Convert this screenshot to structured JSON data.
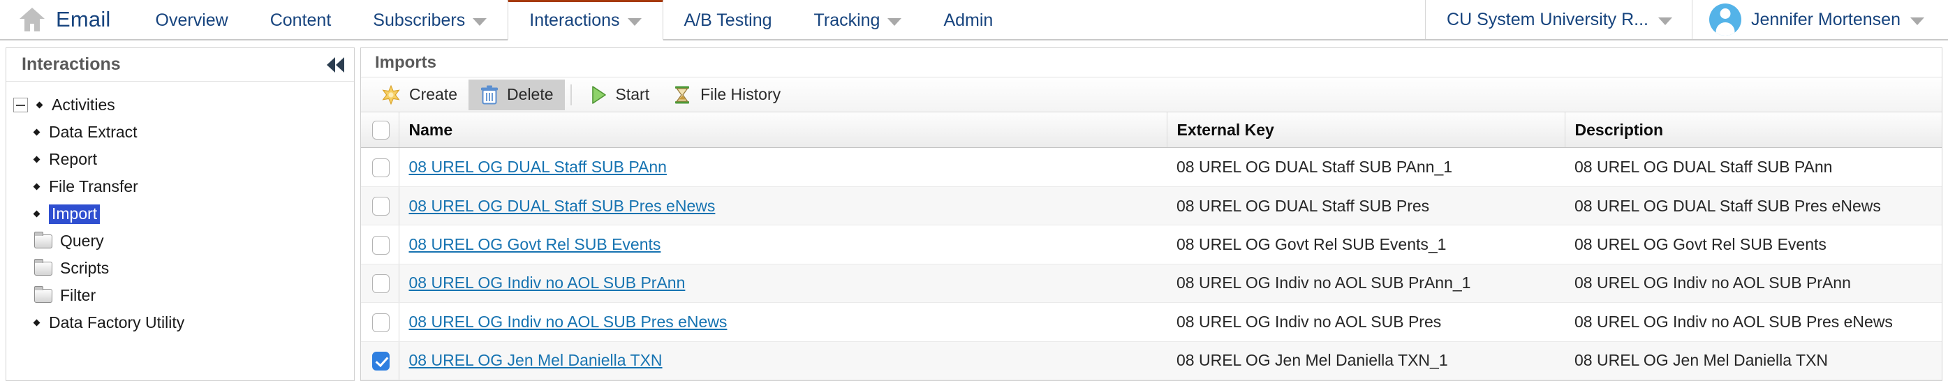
{
  "topnav": {
    "home_icon": "home-icon",
    "app_title": "Email",
    "items": [
      {
        "label": "Overview",
        "has_caret": false,
        "active": false
      },
      {
        "label": "Content",
        "has_caret": false,
        "active": false
      },
      {
        "label": "Subscribers",
        "has_caret": true,
        "active": false
      },
      {
        "label": "Interactions",
        "has_caret": true,
        "active": true
      },
      {
        "label": "A/B Testing",
        "has_caret": false,
        "active": false
      },
      {
        "label": "Tracking",
        "has_caret": true,
        "active": false
      },
      {
        "label": "Admin",
        "has_caret": false,
        "active": false
      }
    ],
    "account": "CU System University R...",
    "user": "Jennifer Mortensen",
    "active_tab_accent": "#a63a0b",
    "link_color": "#17447e"
  },
  "sidebar": {
    "title": "Interactions",
    "collapse_icon": "collapse-left-icon",
    "tree": [
      {
        "label": "Activities",
        "type": "bullet",
        "level": 0,
        "expander": "minus",
        "selected": false
      },
      {
        "label": "Data Extract",
        "type": "bullet",
        "level": 1,
        "expander": "none",
        "selected": false
      },
      {
        "label": "Report",
        "type": "bullet",
        "level": 1,
        "expander": "none",
        "selected": false
      },
      {
        "label": "File Transfer",
        "type": "bullet",
        "level": 1,
        "expander": "none",
        "selected": false
      },
      {
        "label": "Import",
        "type": "bullet",
        "level": 1,
        "expander": "none",
        "selected": true
      },
      {
        "label": "Query",
        "type": "folder",
        "level": 1,
        "expander": "none",
        "selected": false
      },
      {
        "label": "Scripts",
        "type": "folder",
        "level": 1,
        "expander": "none",
        "selected": false
      },
      {
        "label": "Filter",
        "type": "folder",
        "level": 1,
        "expander": "none",
        "selected": false
      },
      {
        "label": "Data Factory Utility",
        "type": "bullet",
        "level": 1,
        "expander": "none",
        "selected": false
      }
    ],
    "selection_bg": "#2f4fd0"
  },
  "content": {
    "title": "Imports",
    "toolbar": [
      {
        "label": "Create",
        "icon": "star-icon",
        "pressed": false
      },
      {
        "label": "Delete",
        "icon": "trash-icon",
        "pressed": true
      },
      {
        "label": "Start",
        "icon": "play-icon",
        "pressed": false
      },
      {
        "label": "File History",
        "icon": "hourglass-icon",
        "pressed": false
      }
    ],
    "table": {
      "select_all_checked": false,
      "columns": [
        "Name",
        "External Key",
        "Description",
        ""
      ],
      "rows": [
        {
          "checked": false,
          "name": "08 UREL OG DUAL Staff SUB PAnn",
          "key": "08 UREL OG DUAL Staff SUB PAnn_1",
          "description": "08 UREL OG DUAL Staff SUB PAnn"
        },
        {
          "checked": false,
          "name": "08 UREL OG DUAL Staff SUB Pres eNews",
          "key": "08 UREL OG DUAL Staff SUB Pres",
          "description": "08 UREL OG DUAL Staff SUB Pres eNews"
        },
        {
          "checked": false,
          "name": "08 UREL OG Govt Rel SUB Events",
          "key": "08 UREL OG Govt Rel SUB Events_1",
          "description": "08 UREL OG Govt Rel SUB Events"
        },
        {
          "checked": false,
          "name": "08 UREL OG Indiv no AOL SUB PrAnn",
          "key": "08 UREL OG Indiv no AOL SUB PrAnn_1",
          "description": "08 UREL OG Indiv no AOL SUB PrAnn"
        },
        {
          "checked": false,
          "name": "08 UREL OG Indiv no AOL SUB Pres eNews",
          "key": "08 UREL OG Indiv no AOL SUB Pres",
          "description": "08 UREL OG Indiv no AOL SUB Pres eNews"
        },
        {
          "checked": true,
          "name": "08 UREL OG Jen Mel Daniella TXN",
          "key": "08 UREL OG Jen Mel Daniella TXN_1",
          "description": "08 UREL OG Jen Mel Daniella TXN"
        }
      ]
    }
  }
}
